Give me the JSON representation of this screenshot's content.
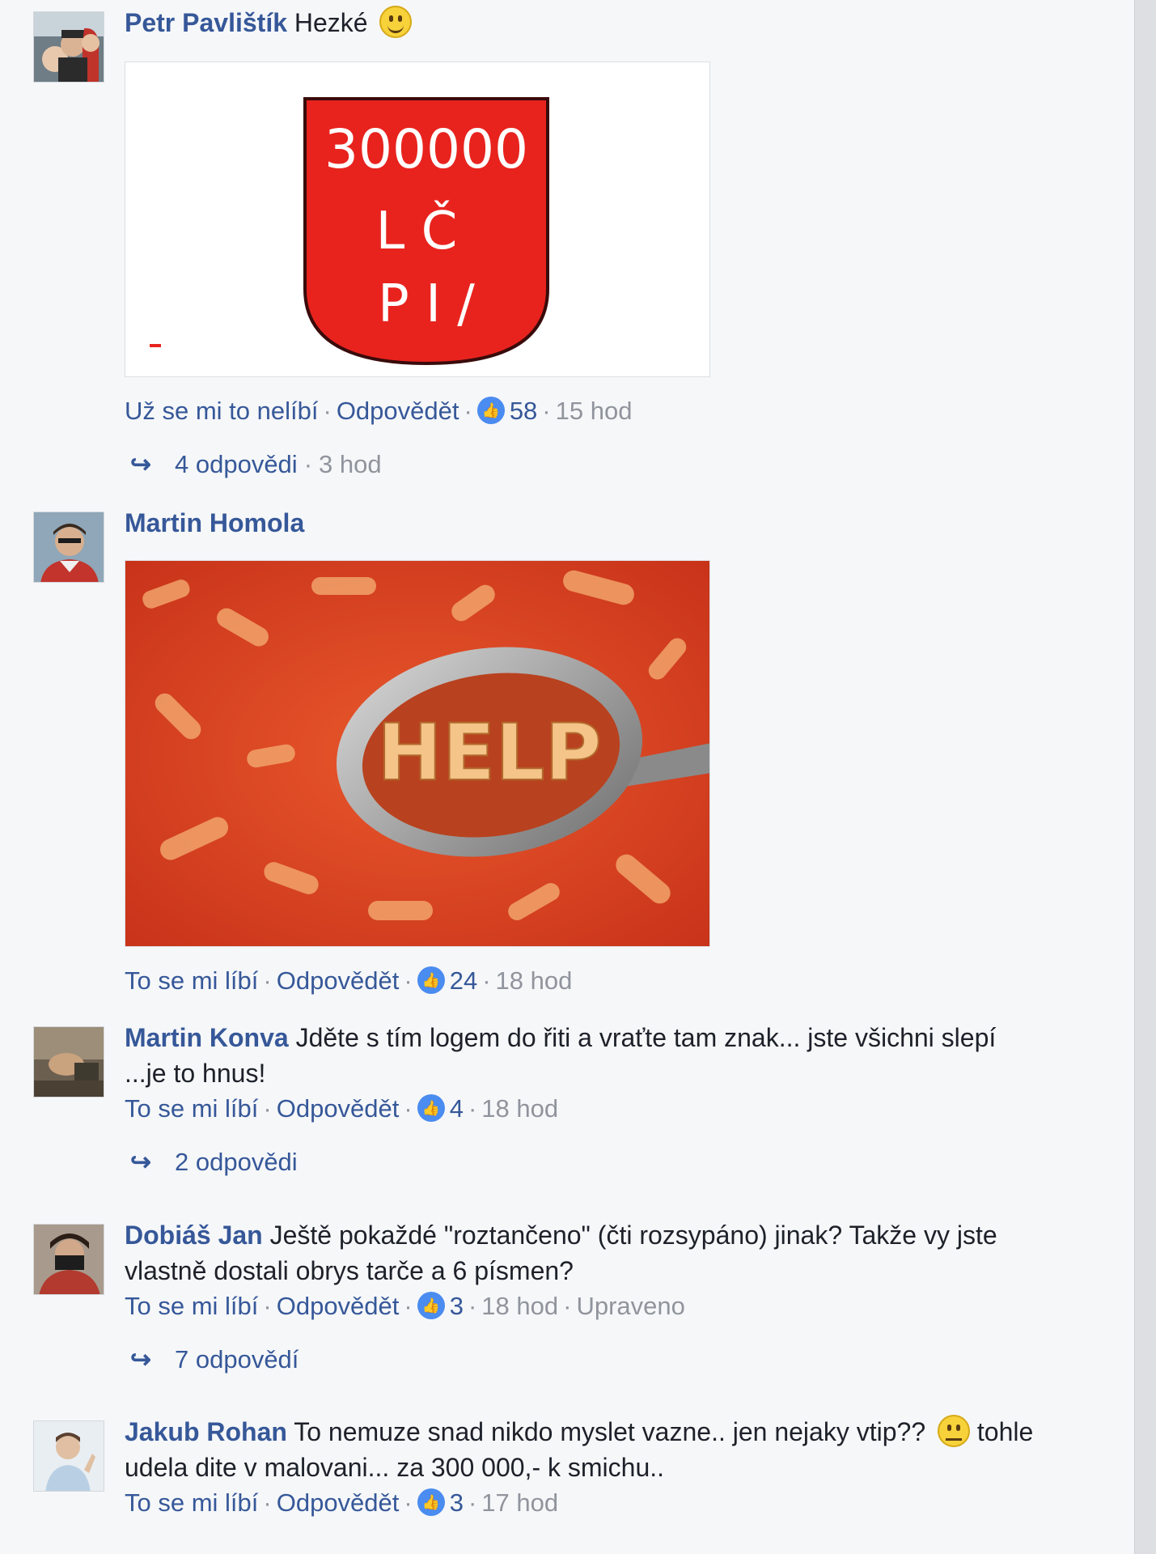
{
  "comments": [
    {
      "author": "Petr Pavlištík",
      "text": "Hezké",
      "emoji": "grin-emoji",
      "like_label": "Už se mi to nelíbí",
      "reply_label": "Odpovědět",
      "likes": "58",
      "time": "15 hod",
      "replies": "4 odpovědi",
      "replies_time": "3 hod"
    },
    {
      "author": "Martin Homola",
      "text": "",
      "like_label": "To se mi líbí",
      "reply_label": "Odpovědět",
      "likes": "24",
      "time": "18 hod",
      "image_text": "HELP"
    },
    {
      "author": "Martin Konva",
      "text": "Jděte s tím logem do řiti a vraťte tam znak... jste všichni slepí",
      "text2": "...je to hnus!",
      "like_label": "To se mi líbí",
      "reply_label": "Odpovědět",
      "likes": "4",
      "time": "18 hod",
      "replies": "2 odpovědi"
    },
    {
      "author": "Dobiáš Jan",
      "text": "Ještě pokaždé \"roztančeno\" (čti rozsypáno) jinak? Takže vy jste",
      "text2": "vlastně dostali obrys tarče a 6 písmen?",
      "like_label": "To se mi líbí",
      "reply_label": "Odpovědět",
      "likes": "3",
      "time": "18 hod",
      "edited": "Upraveno",
      "replies": "7 odpovědí"
    },
    {
      "author": "Jakub Rohan",
      "text": "To nemuze snad nikdo myslet vazne.. jen nejaky vtip??",
      "text_after_emoji": "tohle",
      "text2": "udela dite v malovani... za 300 000,- k smichu..",
      "like_label": "To se mi líbí",
      "reply_label": "Odpovědět",
      "likes": "3",
      "time": "17 hod"
    }
  ],
  "shield_image": {
    "line1": "300000",
    "line2": "L Č",
    "line3": "P I /",
    "color": "#e8231e"
  },
  "colors": {
    "link": "#365899",
    "muted": "#90949c",
    "like": "#4a8cf0",
    "bg": "#f6f7f9"
  }
}
